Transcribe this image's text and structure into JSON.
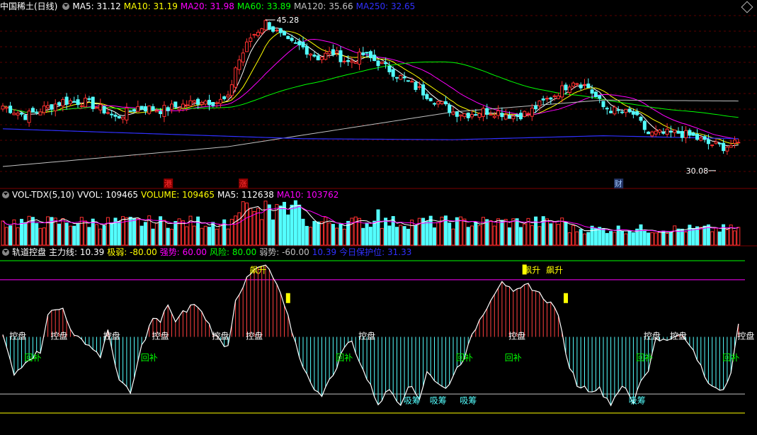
{
  "panes": {
    "price": {
      "title": "中国稀土(日线)",
      "indicators": [
        {
          "label": "MA5: 31.12",
          "color": "#ffffff"
        },
        {
          "label": "MA10: 31.19",
          "color": "#ffff00"
        },
        {
          "label": "MA20: 31.98",
          "color": "#ff00ff"
        },
        {
          "label": "MA60: 33.89",
          "color": "#00ff00"
        },
        {
          "label": "MA120: 35.66",
          "color": "#c0c0c0"
        },
        {
          "label": "MA250: 32.65",
          "color": "#3030ff"
        }
      ],
      "high_label": "45.28",
      "low_label": "30.08",
      "event_markers": [
        {
          "text": "港",
          "color": "#ff3030",
          "bg": "#8b0000"
        },
        {
          "text": "涨",
          "color": "#ff3030",
          "bg": "#8b0000"
        },
        {
          "text": "财",
          "color": "#a0c8ff",
          "bg": "#203060"
        }
      ]
    },
    "volume": {
      "title": "VOL-TDX(5,10)",
      "indicators": [
        {
          "label": "VVOL: 109465",
          "color": "#ffffff"
        },
        {
          "label": "VOLUME: 109465",
          "color": "#ffff00"
        },
        {
          "label": "MA5: 112638",
          "color": "#ffffff"
        },
        {
          "label": "MA10: 103762",
          "color": "#ff00ff"
        }
      ]
    },
    "indicator": {
      "title": "轨道控盘",
      "indicators": [
        {
          "label": "主力线: 10.39",
          "color": "#ffffff"
        },
        {
          "label": "极弱: -80.00",
          "color": "#ffff00"
        },
        {
          "label": "强势: 60.00",
          "color": "#ff00ff"
        },
        {
          "label": "风险: 80.00",
          "color": "#00ff00"
        },
        {
          "label": "弱势: -60.00",
          "color": "#c0c0c0"
        },
        {
          "label": "10.39",
          "color": "#3030ff"
        },
        {
          "label": "今日保护位: 31.33",
          "color": "#3030ff"
        }
      ],
      "labels": {
        "kongpan": "控盘",
        "huibu": "回补",
        "xichou": "吸筹",
        "piaosheng": "飙升"
      }
    }
  },
  "chart_data": [
    {
      "type": "candlestick",
      "title": "中国稀土(日线)",
      "y_range": [
        29,
        46
      ],
      "annotations": {
        "high": 45.28,
        "low": 30.08
      },
      "series": [
        {
          "name": "MA5",
          "color": "#ffffff",
          "last": 31.12
        },
        {
          "name": "MA10",
          "color": "#ffff00",
          "last": 31.19
        },
        {
          "name": "MA20",
          "color": "#ff00ff",
          "last": 31.98
        },
        {
          "name": "MA60",
          "color": "#00ff00",
          "last": 33.89
        },
        {
          "name": "MA120",
          "color": "#c0c0c0",
          "last": 35.66
        },
        {
          "name": "MA250",
          "color": "#3030ff",
          "last": 32.65
        }
      ],
      "close_keys": [
        [
          0,
          36.6
        ],
        [
          6,
          35.6
        ],
        [
          10,
          36.2
        ],
        [
          16,
          37.1
        ],
        [
          22,
          37.0
        ],
        [
          28,
          36.0
        ],
        [
          30,
          35.4
        ],
        [
          36,
          36.5
        ],
        [
          42,
          36.2
        ],
        [
          48,
          36.7
        ],
        [
          53,
          37.2
        ],
        [
          57,
          37.0
        ],
        [
          60,
          37.3
        ],
        [
          62,
          40.5
        ],
        [
          66,
          43.5
        ],
        [
          70,
          45.0
        ],
        [
          76,
          43.0
        ],
        [
          80,
          42.5
        ],
        [
          84,
          41.5
        ],
        [
          88,
          42.0
        ],
        [
          92,
          41.0
        ],
        [
          96,
          41.8
        ],
        [
          100,
          41.0
        ],
        [
          104,
          40.0
        ],
        [
          108,
          39.0
        ],
        [
          112,
          38.0
        ],
        [
          116,
          37.0
        ],
        [
          120,
          36.0
        ],
        [
          124,
          35.8
        ],
        [
          128,
          36.1
        ],
        [
          132,
          36.0
        ],
        [
          136,
          35.6
        ],
        [
          140,
          35.9
        ],
        [
          144,
          37.0
        ],
        [
          148,
          38.0
        ],
        [
          152,
          39.2
        ],
        [
          156,
          38.5
        ],
        [
          160,
          36.5
        ],
        [
          164,
          36.0
        ],
        [
          168,
          35.8
        ],
        [
          172,
          33.8
        ],
        [
          176,
          33.8
        ],
        [
          180,
          33.9
        ],
        [
          184,
          33.5
        ],
        [
          188,
          32.8
        ],
        [
          192,
          32.5
        ],
        [
          196,
          32.8
        ]
      ]
    },
    {
      "type": "bar",
      "title": "VOL-TDX(5,10)",
      "values_last": {
        "VVOL": 109465,
        "VOLUME": 109465,
        "MA5": 112638,
        "MA10": 103762
      }
    },
    {
      "type": "line",
      "title": "轨道控盘",
      "y_range": [
        -80,
        80
      ],
      "reference_lines": [
        {
          "name": "风险",
          "value": 80,
          "color": "#00ff00"
        },
        {
          "name": "强势",
          "value": 60,
          "color": "#ff00ff"
        },
        {
          "name": "弱势",
          "value": -60,
          "color": "#c0c0c0"
        },
        {
          "name": "极弱",
          "value": -80,
          "color": "#ffff00"
        }
      ],
      "series": [
        {
          "name": "主力线",
          "last": 10.39
        }
      ],
      "keys": [
        [
          0,
          2
        ],
        [
          3,
          -40
        ],
        [
          6,
          -25
        ],
        [
          10,
          -15
        ],
        [
          12,
          25
        ],
        [
          16,
          30
        ],
        [
          19,
          0
        ],
        [
          22,
          -5
        ],
        [
          26,
          -20
        ],
        [
          28,
          5
        ],
        [
          31,
          -45
        ],
        [
          34,
          -60
        ],
        [
          37,
          -10
        ],
        [
          40,
          20
        ],
        [
          42,
          15
        ],
        [
          44,
          35
        ],
        [
          46,
          15
        ],
        [
          48,
          25
        ],
        [
          51,
          35
        ],
        [
          54,
          20
        ],
        [
          56,
          5
        ],
        [
          58,
          -5
        ],
        [
          60,
          -10
        ],
        [
          62,
          40
        ],
        [
          65,
          60
        ],
        [
          67,
          70
        ],
        [
          70,
          75
        ],
        [
          73,
          55
        ],
        [
          76,
          20
        ],
        [
          79,
          -20
        ],
        [
          82,
          -50
        ],
        [
          85,
          -60
        ],
        [
          88,
          -40
        ],
        [
          91,
          -10
        ],
        [
          93,
          -5
        ],
        [
          96,
          -35
        ],
        [
          100,
          -70
        ],
        [
          103,
          -55
        ],
        [
          106,
          -70
        ],
        [
          108,
          -50
        ],
        [
          111,
          -65
        ],
        [
          113,
          -35
        ],
        [
          116,
          -50
        ],
        [
          118,
          -55
        ],
        [
          120,
          -40
        ],
        [
          123,
          -20
        ],
        [
          126,
          10
        ],
        [
          130,
          40
        ],
        [
          133,
          60
        ],
        [
          136,
          45
        ],
        [
          140,
          55
        ],
        [
          143,
          45
        ],
        [
          146,
          35
        ],
        [
          148,
          25
        ],
        [
          150,
          -20
        ],
        [
          153,
          -50
        ],
        [
          156,
          -55
        ],
        [
          159,
          -55
        ],
        [
          162,
          -70
        ],
        [
          165,
          -50
        ],
        [
          168,
          -70
        ],
        [
          170,
          -45
        ],
        [
          172,
          -35
        ],
        [
          174,
          0
        ],
        [
          177,
          -5
        ],
        [
          180,
          5
        ],
        [
          184,
          -15
        ],
        [
          188,
          -50
        ],
        [
          192,
          -55
        ],
        [
          194,
          -35
        ],
        [
          196,
          12
        ]
      ]
    }
  ]
}
